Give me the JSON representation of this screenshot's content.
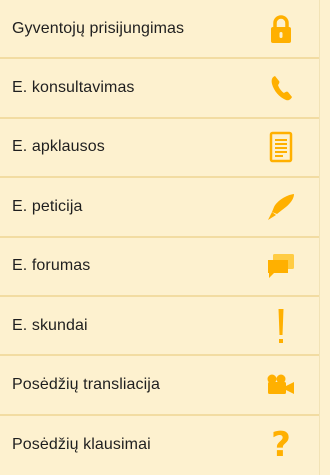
{
  "menu": {
    "accent_color": "#ffb000",
    "items": [
      {
        "label": "Gyventojų prisijungimas",
        "icon": "lock-icon"
      },
      {
        "label": "E. konsultavimas",
        "icon": "phone-icon"
      },
      {
        "label": "E. apklausos",
        "icon": "document-icon"
      },
      {
        "label": "E. peticija",
        "icon": "pen-icon"
      },
      {
        "label": "E. forumas",
        "icon": "chat-bubbles-icon"
      },
      {
        "label": "E. skundai",
        "icon": "exclamation-icon"
      },
      {
        "label": "Posėdžių transliacija",
        "icon": "video-camera-icon"
      },
      {
        "label": "Posėdžių klausimai",
        "icon": "question-icon"
      }
    ]
  }
}
